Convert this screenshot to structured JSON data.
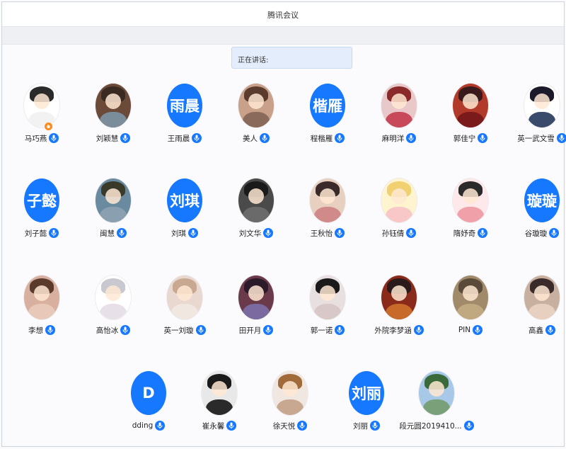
{
  "window": {
    "title": "腾讯会议"
  },
  "speaking": {
    "label": "正在讲话:"
  },
  "colors": {
    "accent": "#1677ff"
  },
  "participants": [
    {
      "name": "马巧燕",
      "avatar": "photo",
      "palette": [
        "#ffffff",
        "#2a2a2a",
        "#f2f2f2"
      ],
      "hand": true
    },
    {
      "name": "刘颖慧",
      "avatar": "photo",
      "palette": [
        "#6b4a3a",
        "#3a2a22",
        "#7b8c9a"
      ]
    },
    {
      "name": "王雨晨",
      "avatar": "text",
      "avatar_text": "雨晨"
    },
    {
      "name": "美人",
      "avatar": "photo",
      "palette": [
        "#c9a08a",
        "#5a3b2c",
        "#8a6a5a"
      ]
    },
    {
      "name": "程楷雁",
      "avatar": "text",
      "avatar_text": "楷雁"
    },
    {
      "name": "麻明洋",
      "avatar": "photo",
      "palette": [
        "#e8c8c8",
        "#8a2a2a",
        "#c84a5a"
      ]
    },
    {
      "name": "郭佳宁",
      "avatar": "photo",
      "palette": [
        "#b23a2a",
        "#3a1a1a",
        "#7a1a1a"
      ]
    },
    {
      "name": "英一武文雪",
      "avatar": "photo",
      "palette": [
        "#ffffff",
        "#1a1a2a",
        "#3a4a6a"
      ]
    },
    {
      "name": "刘子懿",
      "avatar": "text",
      "avatar_text": "子懿"
    },
    {
      "name": "闽慧",
      "avatar": "photo",
      "palette": [
        "#6a8aa0",
        "#3a3a2a",
        "#8aa0b0"
      ]
    },
    {
      "name": "刘琪",
      "avatar": "text",
      "avatar_text": "刘琪"
    },
    {
      "name": "刘文华",
      "avatar": "photo",
      "palette": [
        "#4a4a4a",
        "#1a1a1a",
        "#6a6a6a"
      ]
    },
    {
      "name": "王秋怡",
      "avatar": "photo",
      "palette": [
        "#e8d0c0",
        "#3a2a2a",
        "#d08a8a"
      ]
    },
    {
      "name": "孙钰倩",
      "avatar": "photo",
      "palette": [
        "#fff4d0",
        "#f0d070",
        "#f8c8c8"
      ]
    },
    {
      "name": "隋妤奇",
      "avatar": "photo",
      "palette": [
        "#ffe8ea",
        "#2a2a2a",
        "#f0a0a8"
      ]
    },
    {
      "name": "谷璇璇",
      "avatar": "text",
      "avatar_text": "璇璇"
    },
    {
      "name": "李想",
      "avatar": "photo",
      "palette": [
        "#d8b0a0",
        "#5a3a2a",
        "#e8c8b8"
      ]
    },
    {
      "name": "高怡冰",
      "avatar": "photo",
      "palette": [
        "#ffffff",
        "#c8c8d0",
        "#e8e0e8"
      ]
    },
    {
      "name": "英一刘璇",
      "avatar": "photo",
      "palette": [
        "#e8d8d0",
        "#c8a890",
        "#f0e8e0"
      ]
    },
    {
      "name": "田开月",
      "avatar": "photo",
      "palette": [
        "#6a3a4a",
        "#2a1a2a",
        "#7a6aa0"
      ]
    },
    {
      "name": "郭一诺",
      "avatar": "photo",
      "palette": [
        "#e8e0e0",
        "#1a1a1a",
        "#d8c8c8"
      ]
    },
    {
      "name": "外院李梦涵",
      "avatar": "photo",
      "palette": [
        "#8a2a1a",
        "#2a1a1a",
        "#c86a2a"
      ]
    },
    {
      "name": "PIN",
      "avatar": "photo",
      "palette": [
        "#a08a6a",
        "#5a4a3a",
        "#c0a880"
      ]
    },
    {
      "name": "高鑫",
      "avatar": "photo",
      "palette": [
        "#c8b0a0",
        "#3a2a2a",
        "#e8d0c0"
      ]
    },
    {
      "name": "dding",
      "avatar": "text",
      "avatar_text": "D"
    },
    {
      "name": "崔永馨",
      "avatar": "photo",
      "palette": [
        "#e8e8e8",
        "#1a1a1a",
        "#2a2a2a"
      ]
    },
    {
      "name": "徐天悦",
      "avatar": "photo",
      "palette": [
        "#f0e8e0",
        "#a06a3a",
        "#c8a890"
      ]
    },
    {
      "name": "刘丽",
      "avatar": "text",
      "avatar_text": "刘丽"
    },
    {
      "name": "段元圆2019410...",
      "avatar": "photo",
      "palette": [
        "#a8c8e8",
        "#3a6a3a",
        "#7aa07a"
      ]
    }
  ]
}
